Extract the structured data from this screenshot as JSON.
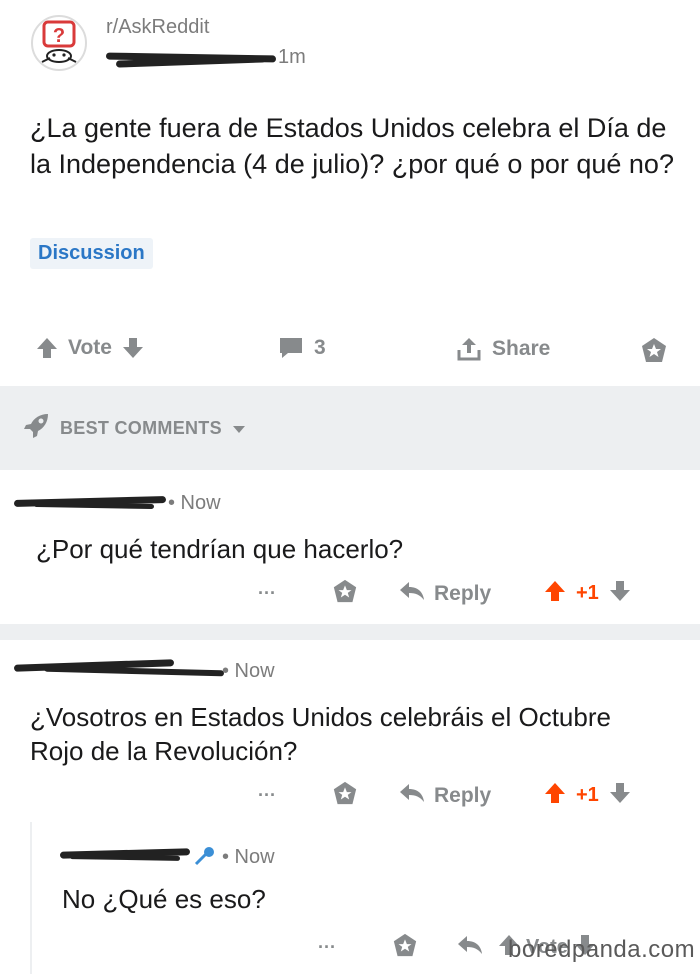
{
  "post": {
    "subreddit": "r/AskReddit",
    "time": "1m",
    "title": "¿La gente fuera de Estados Unidos celebra el Día de la Independencia (4 de julio)? ¿por qué o por qué no?",
    "flair": "Discussion",
    "actions": {
      "vote_label": "Vote",
      "comment_count": "3",
      "share_label": "Share"
    }
  },
  "sort": {
    "label": "BEST COMMENTS"
  },
  "comments": [
    {
      "time": "• Now",
      "body": "¿Por qué tendrían que hacerlo?",
      "ellipsis": "···",
      "reply_label": "Reply",
      "score": "+1"
    },
    {
      "time": "• Now",
      "body": "¿Vosotros en Estados Unidos celebráis el Octubre Rojo de la Revolución?",
      "ellipsis": "···",
      "reply_label": "Reply",
      "score": "+1"
    },
    {
      "time": "• Now",
      "body": "No ¿Qué es eso?",
      "ellipsis": "···",
      "vote_label": "Vote"
    }
  ],
  "watermark": "boredpanda.com",
  "colors": {
    "upvote_active": "#ff4500",
    "icon_gray": "#878a8c",
    "flair_bg": "#eef3f8",
    "flair_text": "#2b77c6",
    "band": "#edeff1"
  }
}
